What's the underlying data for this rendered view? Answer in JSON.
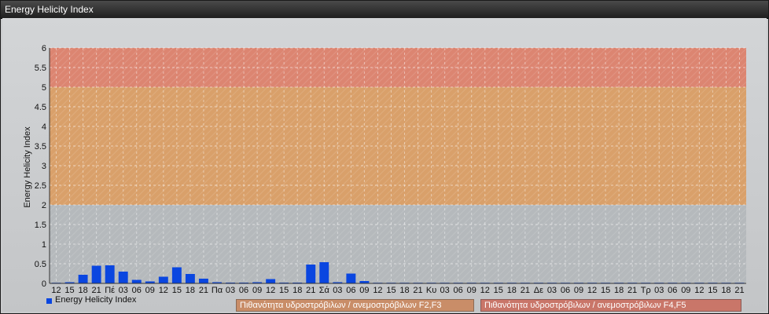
{
  "window": {
    "title": "Energy Helicity Index"
  },
  "chart_data": {
    "type": "bar",
    "title": "",
    "ylabel": "Energy Helicity Index",
    "xlabel": "",
    "ylim": [
      0,
      6
    ],
    "yticks": [
      "0",
      "0.5",
      "1",
      "1.5",
      "2",
      "2.5",
      "3",
      "3.5",
      "4",
      "4.5",
      "5",
      "5.5",
      "6"
    ],
    "grid": true,
    "legend_placement": "bottom-left",
    "categories": [
      "12",
      "15",
      "18",
      "21",
      "Πέ",
      "03",
      "06",
      "09",
      "12",
      "15",
      "18",
      "21",
      "Πα",
      "03",
      "06",
      "09",
      "12",
      "15",
      "18",
      "21",
      "Σά",
      "03",
      "06",
      "09",
      "12",
      "15",
      "18",
      "21",
      "Κυ",
      "03",
      "06",
      "09",
      "12",
      "15",
      "18",
      "21",
      "Δε",
      "03",
      "06",
      "09",
      "12",
      "15",
      "18",
      "21",
      "Τρ",
      "03",
      "06",
      "09",
      "12",
      "15",
      "18",
      "21"
    ],
    "series": [
      {
        "name": "Energy Helicity Index",
        "color": "#0a46e0",
        "values": [
          0.01,
          0.03,
          0.22,
          0.45,
          0.46,
          0.3,
          0.09,
          0.05,
          0.17,
          0.41,
          0.24,
          0.12,
          0.03,
          0.02,
          0.02,
          0.03,
          0.11,
          0.02,
          0.02,
          0.48,
          0.54,
          0.03,
          0.25,
          0.06,
          0.01,
          0.01,
          0.01,
          0.01,
          0.01,
          0.01,
          0.01,
          0.01,
          0.01,
          0.01,
          0.01,
          0.01,
          0.01,
          0.01,
          0.01,
          0.01,
          0.01,
          0.01,
          0.01,
          0.01,
          0.01,
          0.01,
          0.01,
          0.01,
          0.01,
          0.01,
          0.01,
          0.01
        ]
      }
    ],
    "bands": [
      {
        "from": 0,
        "to": 2,
        "color": "#b5b9bc",
        "label": ""
      },
      {
        "from": 2,
        "to": 5,
        "color": "#d9a06a",
        "label": "Πιθανότητα υδροστρόβιλων / ανεμοστρόβιλων F2,F3"
      },
      {
        "from": 5,
        "to": 6,
        "color": "#dc8571",
        "label": "Πιθανότητα υδροστρόβιλων / ανεμοστρόβιλων F4,F5"
      }
    ]
  }
}
